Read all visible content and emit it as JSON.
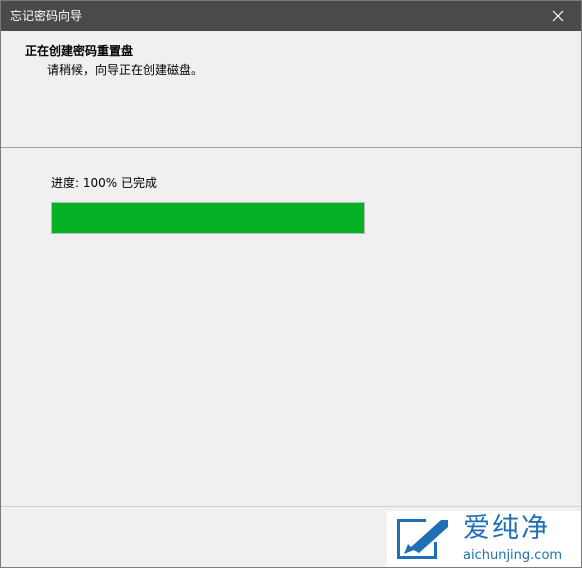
{
  "window": {
    "title": "忘记密码向导",
    "close_icon": "close-icon"
  },
  "header": {
    "title": "正在创建密码重置盘",
    "subtitle": "请稍候，向导正在创建磁盘。"
  },
  "progress": {
    "label": "进度: 100% 已完成",
    "fraction": 1.0,
    "fill_color": "#06b025"
  },
  "watermark": {
    "brand_cn": "爱纯净",
    "url": "aichunjing.com",
    "logo_icon": "brand-logo-icon",
    "color": "#1f6fb5"
  }
}
